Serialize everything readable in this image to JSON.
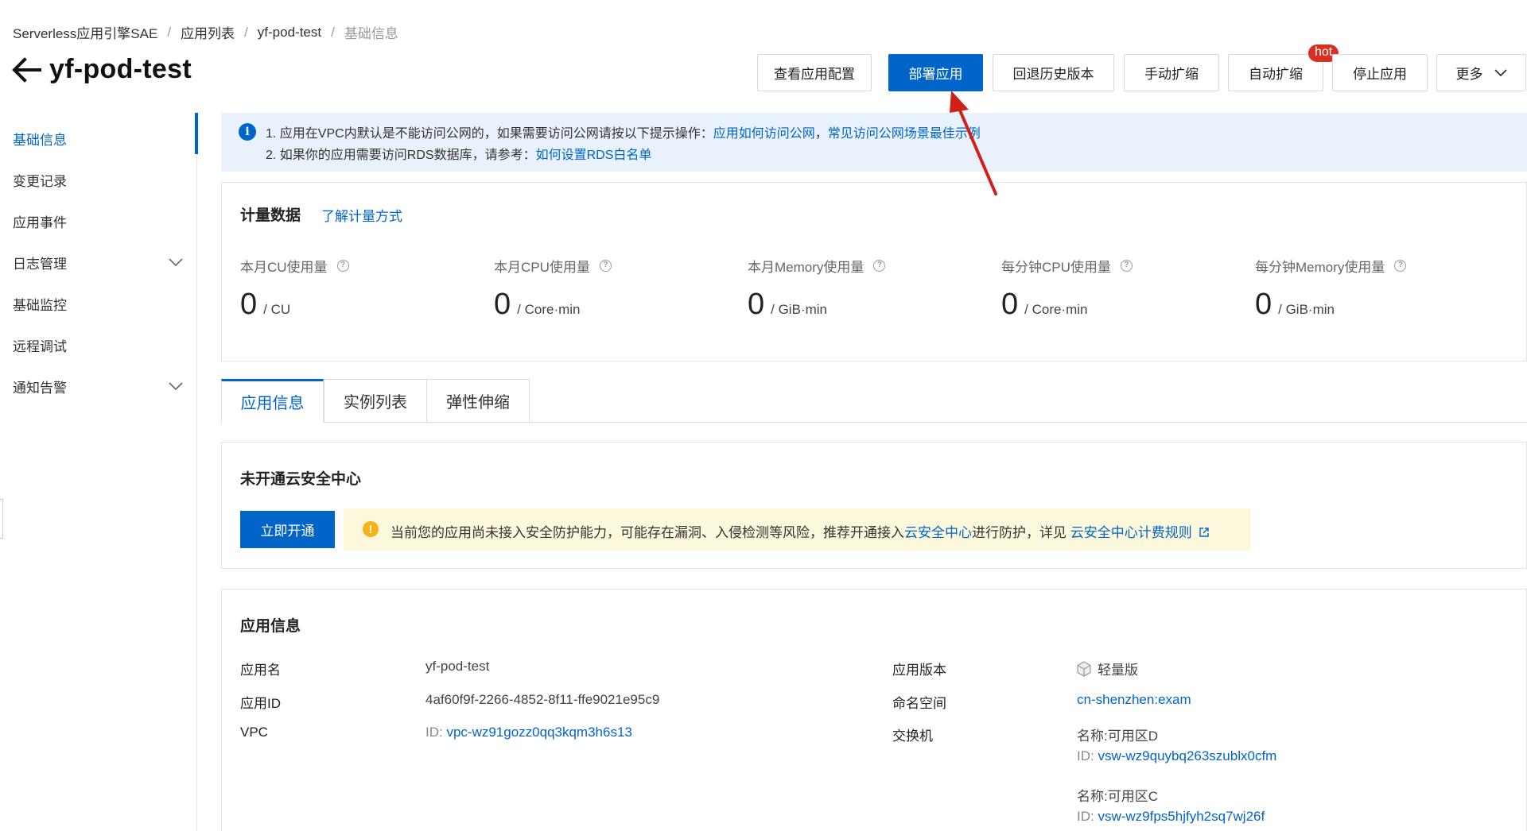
{
  "breadcrumb": [
    "Serverless应用引擎SAE",
    "应用列表",
    "yf-pod-test",
    "基础信息"
  ],
  "page_title": "yf-pod-test",
  "actions": {
    "view_config": "查看应用配置",
    "deploy": "部署应用",
    "rollback": "回退历史版本",
    "manual_scale": "手动扩缩",
    "auto_scale": "自动扩缩",
    "hot_badge": "hot",
    "stop": "停止应用",
    "more": "更多"
  },
  "sidebar": {
    "items": [
      {
        "label": "基础信息"
      },
      {
        "label": "变更记录"
      },
      {
        "label": "应用事件"
      },
      {
        "label": "日志管理"
      },
      {
        "label": "基础监控"
      },
      {
        "label": "远程调试"
      },
      {
        "label": "通知告警"
      }
    ]
  },
  "notice": {
    "line1_prefix": "1. 应用在VPC内默认是不能访问公网的，如果需要访问公网请按以下提示操作：",
    "line1_link1": "应用如何访问公网",
    "line1_sep": "，",
    "line1_link2": "常见访问公网场景最佳示例",
    "line2_prefix": "2. 如果你的应用需要访问RDS数据库，请参考：",
    "line2_link": "如何设置RDS白名单"
  },
  "metering": {
    "title": "计量数据",
    "link": "了解计量方式",
    "metrics": [
      {
        "label": "本月CU使用量",
        "value": "0",
        "unit": "/ CU"
      },
      {
        "label": "本月CPU使用量",
        "value": "0",
        "unit": "/ Core·min"
      },
      {
        "label": "本月Memory使用量",
        "value": "0",
        "unit": "/ GiB·min"
      },
      {
        "label": "每分钟CPU使用量",
        "value": "0",
        "unit": "/ Core·min"
      },
      {
        "label": "每分钟Memory使用量",
        "value": "0",
        "unit": "/ GiB·min"
      }
    ]
  },
  "tabs": [
    {
      "label": "应用信息"
    },
    {
      "label": "实例列表"
    },
    {
      "label": "弹性伸缩"
    }
  ],
  "security": {
    "title": "未开通云安全中心",
    "open_button": "立即开通",
    "warning_prefix": "当前您的应用尚未接入安全防护能力，可能存在漏洞、入侵检测等风险，推荐开通接入",
    "warning_link1": "云安全中心",
    "warning_middle": "进行防护，详见 ",
    "warning_link2": "云安全中心计费规则"
  },
  "app_info": {
    "title": "应用信息",
    "app_name_label": "应用名",
    "app_name": "yf-pod-test",
    "app_id_label": "应用ID",
    "app_id": "4af60f9f-2266-4852-8f11-ffe9021e95c9",
    "vpc_label": "VPC",
    "vpc_id_prefix": "ID: ",
    "vpc_id": "vpc-wz91gozz0qq3kqm3h6s13",
    "version_label": "应用版本",
    "version": "轻量版",
    "namespace_label": "命名空间",
    "namespace": "cn-shenzhen:exam",
    "vswitch_label": "交换机",
    "vswitches": [
      {
        "name": "名称:可用区D",
        "id_prefix": "ID: ",
        "id": "vsw-wz9quybq263szublx0cfm"
      },
      {
        "name": "名称:可用区C",
        "id_prefix": "ID: ",
        "id": "vsw-wz9fps5hjfyh2sq7wj26f"
      }
    ]
  },
  "colors": {
    "brand": "#0064c8",
    "notice_bg": "#e9f2fc",
    "warning_bg": "#fcf8dc",
    "hot": "#d93026",
    "annotation_arrow": "#d0201a"
  }
}
